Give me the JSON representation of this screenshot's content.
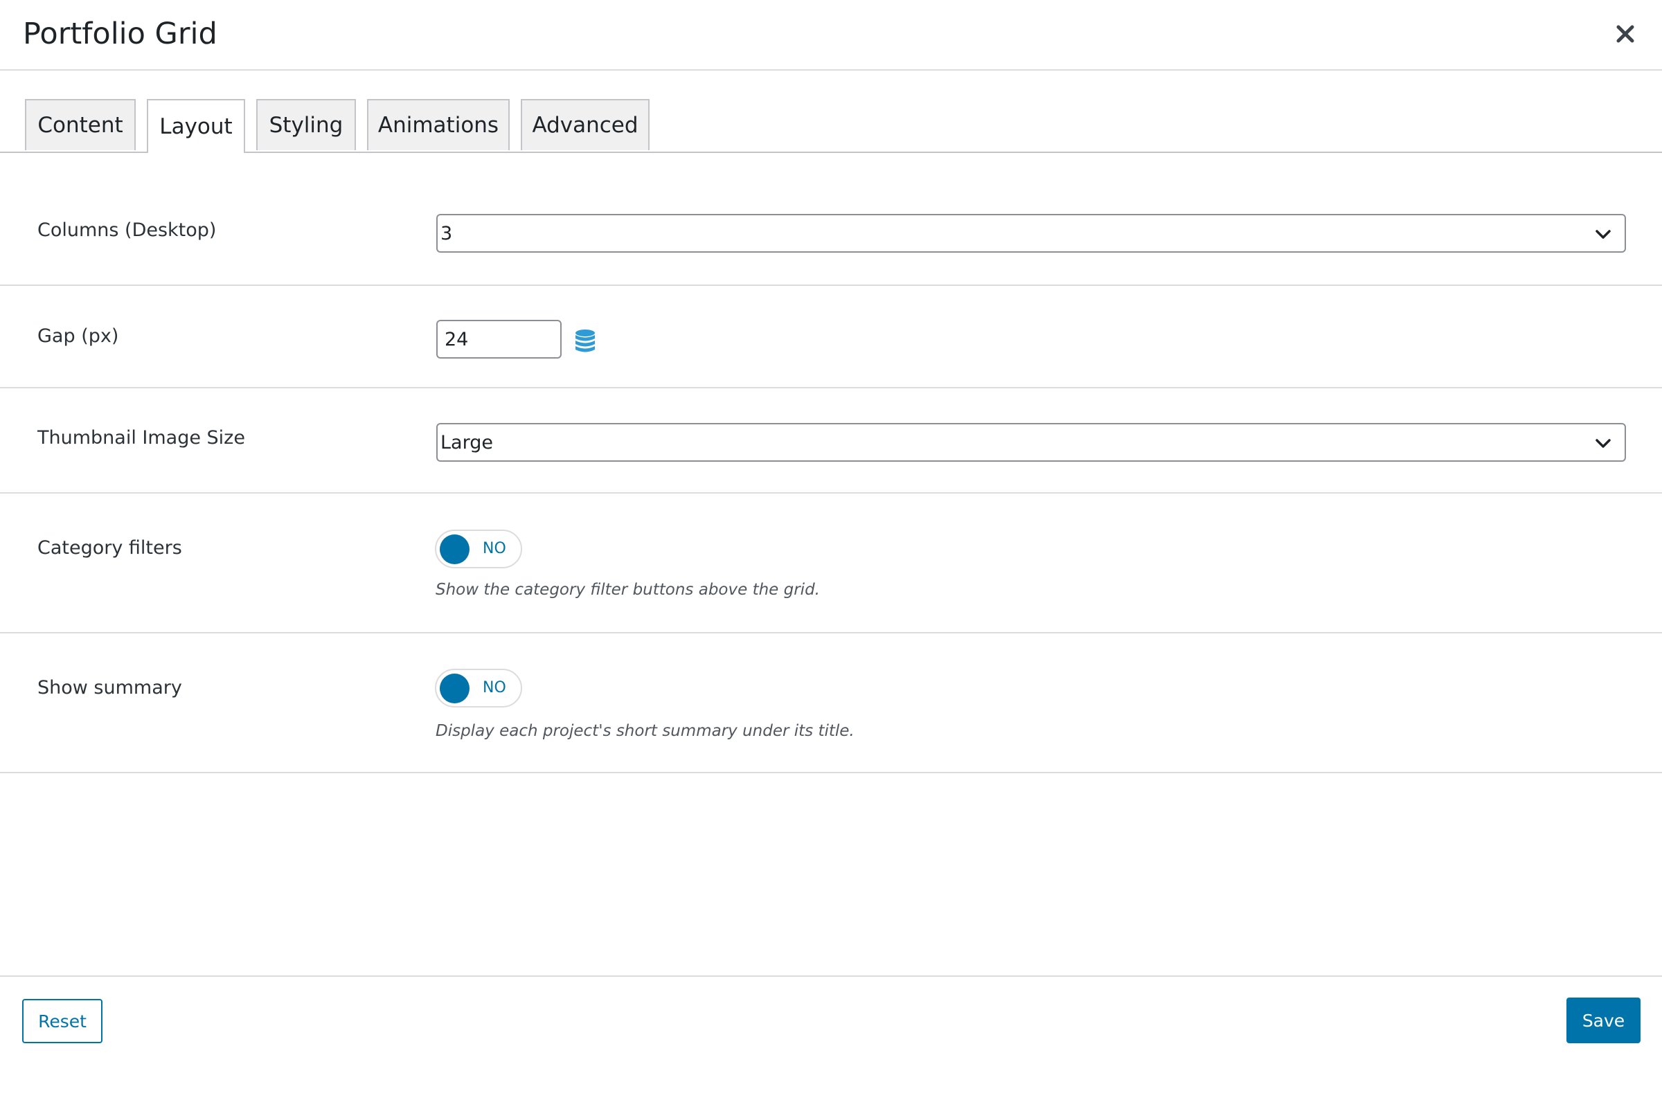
{
  "modal": {
    "title": "Portfolio Grid"
  },
  "tabs": [
    {
      "label": "Content",
      "active": false
    },
    {
      "label": "Layout",
      "active": true
    },
    {
      "label": "Styling",
      "active": false
    },
    {
      "label": "Animations",
      "active": false
    },
    {
      "label": "Advanced",
      "active": false
    }
  ],
  "fields": {
    "columns": {
      "label": "Columns (Desktop)",
      "value": "3"
    },
    "gap": {
      "label": "Gap (px)",
      "value": "24",
      "icon": "database-icon"
    },
    "thumbnail": {
      "label": "Thumbnail Image Size",
      "value": "Large"
    },
    "category_filters": {
      "label": "Category filters",
      "toggle_text": "NO",
      "help": "Show the category filter buttons above the grid."
    },
    "show_summary": {
      "label": "Show summary",
      "toggle_text": "NO",
      "help": "Display each project's short summary under its title."
    }
  },
  "footer": {
    "reset_label": "Reset",
    "save_label": "Save"
  },
  "colors": {
    "accent": "#0073aa",
    "border": "#dcdcde",
    "tab_bg": "#f0f0f1",
    "text": "#1d2327"
  }
}
